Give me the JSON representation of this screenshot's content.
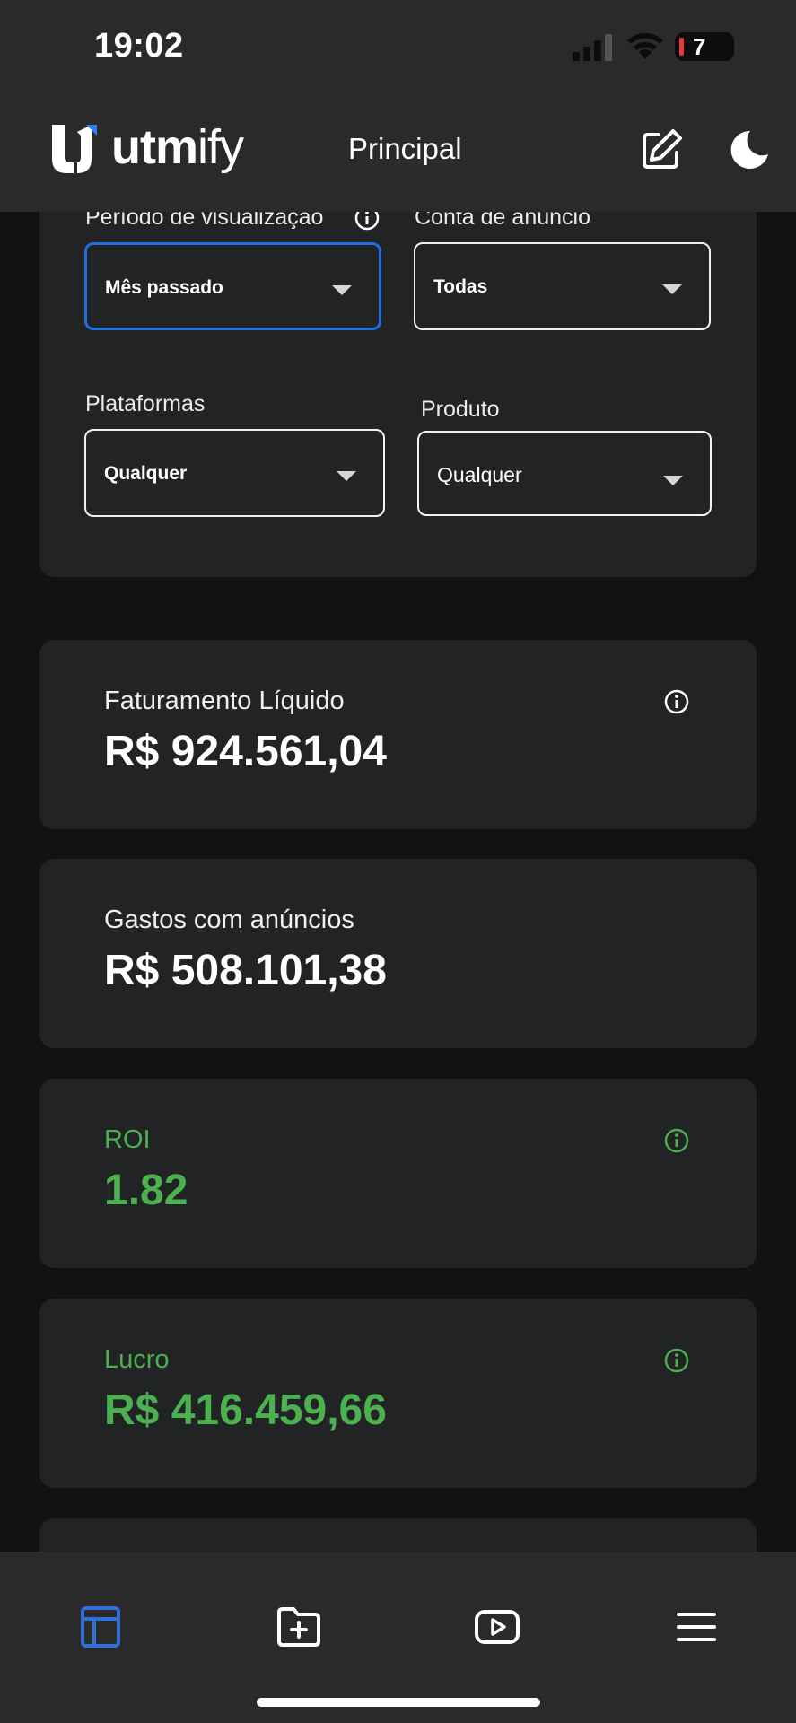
{
  "status_bar": {
    "time": "19:02",
    "battery": "7"
  },
  "header": {
    "brand_bold": "utm",
    "brand_light": "ify",
    "title": "Principal",
    "icons": [
      "edit-icon",
      "moon-icon"
    ]
  },
  "filters": {
    "period": {
      "label": "Período de visualização",
      "value": "Mês passado"
    },
    "ad_account": {
      "label": "Conta de anúncio",
      "value": "Todas"
    },
    "platforms": {
      "label": "Plataformas",
      "value": "Qualquer"
    },
    "product": {
      "label": "Produto",
      "value": "Qualquer"
    }
  },
  "metrics": [
    {
      "label": "Faturamento Líquido",
      "value": "R$ 924.561,04",
      "info": true
    },
    {
      "label": "Gastos com anúncios",
      "value": "R$ 508.101,38",
      "info": false
    },
    {
      "label": "ROI",
      "value": "1.82",
      "info": true
    },
    {
      "label": "Lucro",
      "value": "R$ 416.459,66",
      "info": true
    }
  ],
  "colors": {
    "background": "#121212",
    "card": "#222324",
    "topbar": "#2a2a2a",
    "accent_blue": "#1f6fe0",
    "positive_green": "#4caf50"
  },
  "bottom_nav": [
    "dashboard-icon",
    "folder-add-icon",
    "video-play-icon",
    "menu-icon"
  ]
}
